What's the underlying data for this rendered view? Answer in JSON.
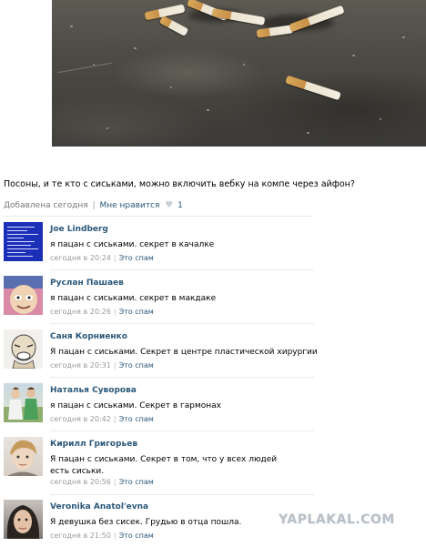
{
  "post": {
    "text": "Посоны, и те кто с сиськами, можно включить вебку на компе через айфон?",
    "added": "Добавлена сегодня",
    "separator": "|",
    "like_label": "Мне нравится",
    "like_count": "1"
  },
  "comments": [
    {
      "name": "Joe Lindberg",
      "text": "я пацан с сиськами. секрет в качалке",
      "time": "сегодня в 20:24",
      "spam": "Это спам"
    },
    {
      "name": "Руслан Пашаев",
      "text": "я пацан с сиськами. секрет в макдаке",
      "time": "сегодня в 20:26",
      "spam": "Это спам"
    },
    {
      "name": "Саня Корниенко",
      "text": "Я пацан с сиськами. Секрет в центре пластической хирургии",
      "time": "сегодня в 20:31",
      "spam": "Это спам"
    },
    {
      "name": "Наталья Суворова",
      "text": "я пацан с сиськами. Секрет в гармонах",
      "time": "сегодня в 20:42",
      "spam": "Это спам"
    },
    {
      "name": "Кирилл Григорьев",
      "text": "Я пацан с сиськами. Секрет в том, что у всех людей есть сиськи.",
      "time": "сегодня в 20:56",
      "spam": "Это спам"
    },
    {
      "name": "Veronika Anatol'evna",
      "text": "Я девушка без сисек. Грудью в отца пошла.",
      "time": "сегодня в 21:50",
      "spam": "Это спам"
    }
  ],
  "watermark": "YAPLAKAL.COM",
  "colors": {
    "link": "#2b587a",
    "meta": "#999999",
    "divider": "#e7eaed"
  }
}
